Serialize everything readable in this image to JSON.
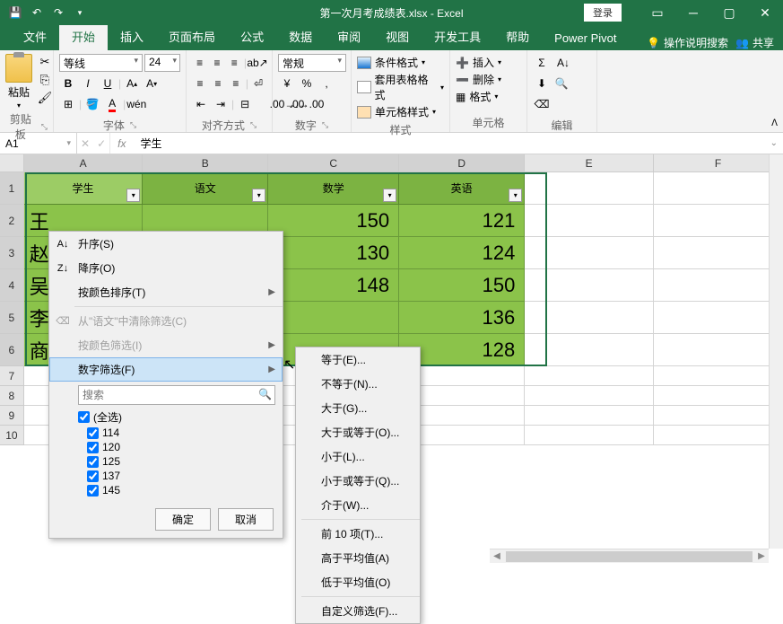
{
  "titlebar": {
    "title": "第一次月考成绩表.xlsx - Excel",
    "login": "登录"
  },
  "tabs": {
    "file": "文件",
    "home": "开始",
    "insert": "插入",
    "layout": "页面布局",
    "formula": "公式",
    "data": "数据",
    "review": "审阅",
    "view": "视图",
    "dev": "开发工具",
    "help": "帮助",
    "pivot": "Power Pivot",
    "tellme": "操作说明搜索",
    "share": "共享"
  },
  "ribbon": {
    "paste": "粘贴",
    "clipboard": "剪贴板",
    "font_name": "等线",
    "font_size": "24",
    "font": "字体",
    "align": "对齐方式",
    "number": "数字",
    "number_fmt": "常规",
    "cond_fmt": "条件格式",
    "table_fmt": "套用表格格式",
    "cell_style": "单元格样式",
    "styles": "样式",
    "insert_c": "插入",
    "delete_c": "删除",
    "format_c": "格式",
    "cells": "单元格",
    "edit": "编辑"
  },
  "namebox": "A1",
  "formula_value": "学生",
  "cols": {
    "A": "A",
    "B": "B",
    "C": "C",
    "D": "D",
    "E": "E",
    "F": "F"
  },
  "headers": {
    "student": "学生",
    "chinese": "语文",
    "math": "数学",
    "english": "英语"
  },
  "names": [
    "王",
    "赵",
    "吴",
    "李",
    "商"
  ],
  "rows": [
    {
      "math": "150",
      "eng": "121"
    },
    {
      "math": "130",
      "eng": "124"
    },
    {
      "math": "148",
      "eng": "150"
    },
    {
      "math": "",
      "eng": "136"
    },
    {
      "math": "",
      "eng": "128"
    }
  ],
  "menu": {
    "asc": "升序(S)",
    "desc": "降序(O)",
    "sort_color": "按颜色排序(T)",
    "clear": "从\"语文\"中清除筛选(C)",
    "filter_color": "按颜色筛选(I)",
    "num_filter": "数字筛选(F)",
    "search": "搜索",
    "all": "(全选)",
    "v1": "114",
    "v2": "120",
    "v3": "125",
    "v4": "137",
    "v5": "145",
    "ok": "确定",
    "cancel": "取消"
  },
  "submenu": {
    "eq": "等于(E)...",
    "neq": "不等于(N)...",
    "gt": "大于(G)...",
    "gte": "大于或等于(O)...",
    "lt": "小于(L)...",
    "lte": "小于或等于(Q)...",
    "between": "介于(W)...",
    "top10": "前 10 项(T)...",
    "above": "高于平均值(A)",
    "below": "低于平均值(O)",
    "custom": "自定义筛选(F)..."
  },
  "chart_data": {
    "type": "table",
    "title": "第一次月考成绩表",
    "columns": [
      "学生",
      "语文",
      "数学",
      "英语"
    ],
    "filter_values_chinese": [
      114,
      120,
      125,
      137,
      145
    ],
    "visible_rows": [
      {
        "数学": 150,
        "英语": 121
      },
      {
        "数学": 130,
        "英语": 124
      },
      {
        "数学": 148,
        "英语": 150
      },
      {
        "英语": 136
      },
      {
        "英语": 128
      }
    ]
  }
}
